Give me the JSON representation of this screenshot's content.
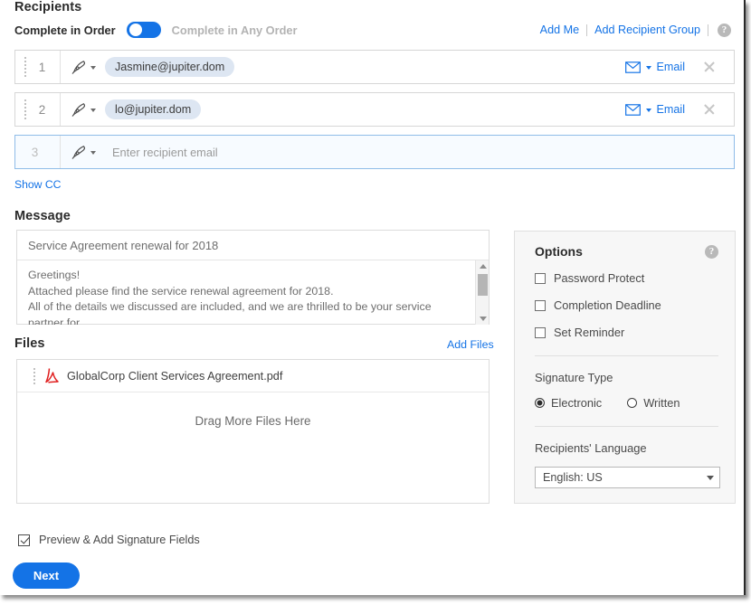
{
  "recipients": {
    "title": "Recipients",
    "order_label": "Complete in Order",
    "order_label_alt": "Complete in Any Order",
    "toggle_state": "Complete in Order",
    "add_me": "Add Me",
    "add_recipient_group": "Add Recipient Group",
    "help_glyph": "?",
    "rows": [
      {
        "number": "1",
        "email": "Jasmine@jupiter.dom",
        "role_icon": "signature-pen-icon",
        "delivery_icon": "envelope-icon",
        "delivery_label": "Email",
        "remove_icon": "close-icon"
      },
      {
        "number": "2",
        "email": "lo@jupiter.dom",
        "role_icon": "signature-pen-icon",
        "delivery_icon": "envelope-icon",
        "delivery_label": "Email",
        "remove_icon": "close-icon"
      },
      {
        "number": "3",
        "email": "",
        "placeholder": "Enter recipient email",
        "role_icon": "signature-pen-icon"
      }
    ],
    "show_cc": "Show CC"
  },
  "message": {
    "title": "Message",
    "subject": "Service Agreement renewal for 2018",
    "body": "Greetings!\nAttached please find the service renewal agreement for 2018.\nAll of the details we discussed are included, and we are thrilled to be your service partner for"
  },
  "files": {
    "title": "Files",
    "add_files": "Add Files",
    "items": [
      {
        "name": "GlobalCorp Client Services Agreement.pdf",
        "icon": "pdf-icon"
      }
    ],
    "dropzone_text": "Drag More Files Here"
  },
  "options": {
    "title": "Options",
    "help_glyph": "?",
    "checkboxes": [
      {
        "label": "Password Protect",
        "checked": false
      },
      {
        "label": "Completion Deadline",
        "checked": false
      },
      {
        "label": "Set Reminder",
        "checked": false
      }
    ],
    "signature_type": {
      "title": "Signature Type",
      "choices": [
        {
          "label": "Electronic",
          "selected": true
        },
        {
          "label": "Written",
          "selected": false
        }
      ]
    },
    "language": {
      "title": "Recipients' Language",
      "selected": "English: US"
    }
  },
  "footer": {
    "preview_label": "Preview & Add Signature Fields",
    "preview_checked": true,
    "next_label": "Next"
  },
  "colors": {
    "accent_blue": "#1473e6",
    "chip_bg": "#dde6f2",
    "panel_bg": "#f7f7f7",
    "pdf_red": "#e02020"
  }
}
